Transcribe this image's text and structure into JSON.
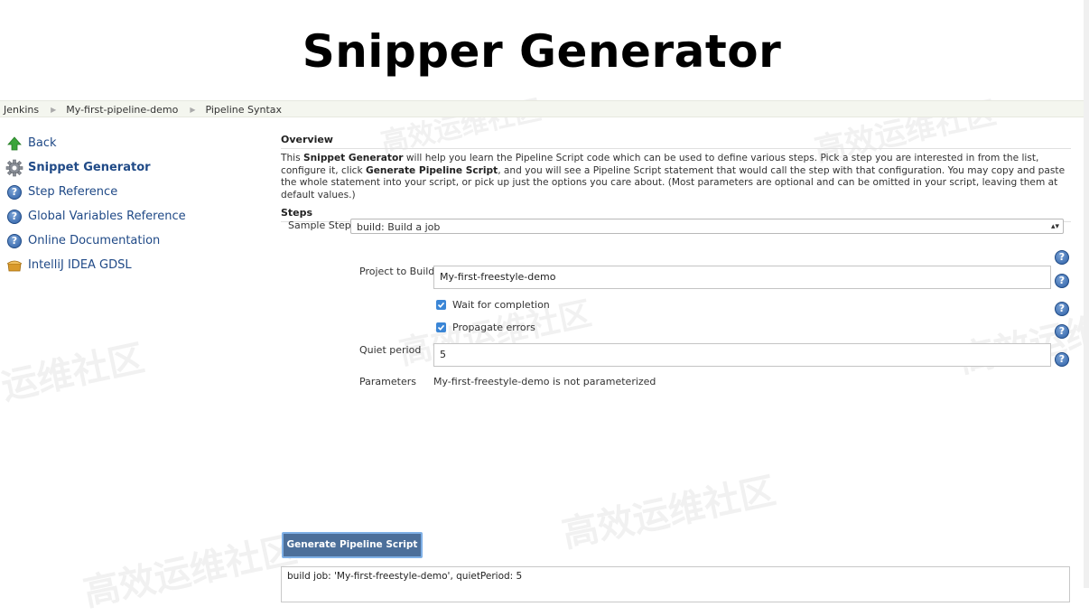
{
  "title": "Snipper Generator",
  "breadcrumb": [
    "Jenkins",
    "My-first-pipeline-demo",
    "Pipeline Syntax"
  ],
  "sidebar": {
    "items": [
      {
        "label": "Back",
        "icon": "up-arrow-icon"
      },
      {
        "label": "Snippet Generator",
        "icon": "gear-icon",
        "active": true
      },
      {
        "label": "Step Reference",
        "icon": "help-icon"
      },
      {
        "label": "Global Variables Reference",
        "icon": "help-icon"
      },
      {
        "label": "Online Documentation",
        "icon": "help-icon"
      },
      {
        "label": "IntelliJ IDEA GDSL",
        "icon": "package-icon"
      }
    ]
  },
  "overview": {
    "heading": "Overview",
    "text_1": "This ",
    "bold_1": "Snippet Generator",
    "text_2": " will help you learn the Pipeline Script code which can be used to define various steps. Pick a step you are interested in from the list, configure it, click ",
    "bold_2": "Generate Pipeline Script",
    "text_3": ", and you will see a Pipeline Script statement that would call the step with that configuration. You may copy and paste the whole statement into your script, or pick up just the options you care about. (Most parameters are optional and can be omitted in your script, leaving them at default values.)"
  },
  "steps": {
    "heading": "Steps",
    "sample_step_label": "Sample Step",
    "sample_step_value": "build: Build a job"
  },
  "form": {
    "project_label": "Project to Build",
    "project_value": "My-first-freestyle-demo",
    "wait_label": "Wait for completion",
    "wait_checked": true,
    "propagate_label": "Propagate errors",
    "propagate_checked": true,
    "quiet_label": "Quiet period",
    "quiet_value": "5",
    "params_label": "Parameters",
    "params_value": "My-first-freestyle-demo is not parameterized"
  },
  "generate_button": "Generate Pipeline Script",
  "output": "build job: 'My-first-freestyle-demo', quietPeriod: 5",
  "colors": {
    "link": "#204a87",
    "button": "#4c6f9a",
    "checkbox": "#3b86d6",
    "breadcrumb_bg": "#f4f6ef"
  }
}
